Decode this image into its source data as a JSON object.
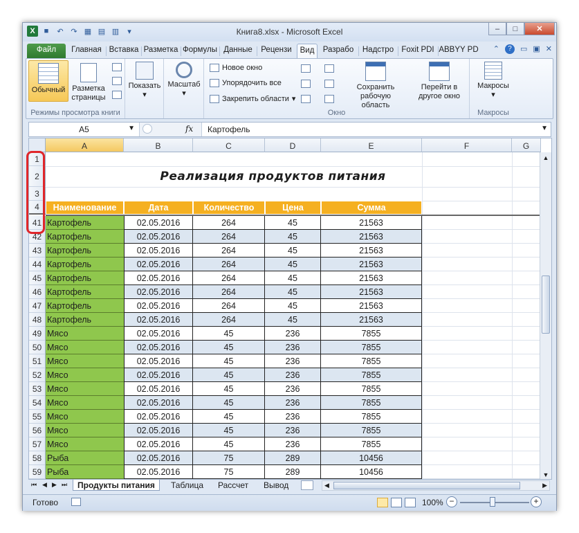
{
  "window": {
    "title": "Книга8.xlsx - Microsoft Excel"
  },
  "ribbon_tabs": [
    {
      "label": "Файл",
      "kind": "file"
    },
    {
      "label": "Главная"
    },
    {
      "label": "Вставка"
    },
    {
      "label": "Разметка"
    },
    {
      "label": "Формулы"
    },
    {
      "label": "Данные"
    },
    {
      "label": "Рецензи"
    },
    {
      "label": "Вид",
      "kind": "active"
    },
    {
      "label": "Разрабо"
    },
    {
      "label": "Надстро"
    },
    {
      "label": "Foxit PDI"
    },
    {
      "label": "ABBYY PD"
    }
  ],
  "ribbon": {
    "group1": {
      "label": "Режимы просмотра книги",
      "normal": "Обычный",
      "page_layout": "Разметка страницы"
    },
    "group2": {
      "show": "Показать"
    },
    "group3": {
      "zoom": "Масштаб"
    },
    "window_group": {
      "label": "Окно",
      "new_window": "Новое окно",
      "arrange_all": "Упорядочить все",
      "freeze_panes": "Закрепить области",
      "save_workspace": "Сохранить рабочую область",
      "switch_windows": "Перейти в другое окно"
    },
    "macros": {
      "button": "Макросы",
      "label": "Макросы"
    }
  },
  "formula_bar": {
    "name_box": "A5",
    "fx": "fx",
    "value": "Картофель"
  },
  "columns": [
    "A",
    "B",
    "C",
    "D",
    "E",
    "F",
    "G"
  ],
  "sheet": {
    "title": "Реализация продуктов питания",
    "headers": [
      "Наименование",
      "Дата",
      "Количество",
      "Цена",
      "Сумма"
    ],
    "top_rows": [
      "1",
      "2",
      "3",
      "4"
    ],
    "rows": [
      {
        "num": "41",
        "name": "Картофель",
        "date": "02.05.2016",
        "qty": "264",
        "price": "45",
        "sum": "21563"
      },
      {
        "num": "42",
        "name": "Картофель",
        "date": "02.05.2016",
        "qty": "264",
        "price": "45",
        "sum": "21563"
      },
      {
        "num": "43",
        "name": "Картофель",
        "date": "02.05.2016",
        "qty": "264",
        "price": "45",
        "sum": "21563"
      },
      {
        "num": "44",
        "name": "Картофель",
        "date": "02.05.2016",
        "qty": "264",
        "price": "45",
        "sum": "21563"
      },
      {
        "num": "45",
        "name": "Картофель",
        "date": "02.05.2016",
        "qty": "264",
        "price": "45",
        "sum": "21563"
      },
      {
        "num": "46",
        "name": "Картофель",
        "date": "02.05.2016",
        "qty": "264",
        "price": "45",
        "sum": "21563"
      },
      {
        "num": "47",
        "name": "Картофель",
        "date": "02.05.2016",
        "qty": "264",
        "price": "45",
        "sum": "21563"
      },
      {
        "num": "48",
        "name": "Картофель",
        "date": "02.05.2016",
        "qty": "264",
        "price": "45",
        "sum": "21563"
      },
      {
        "num": "49",
        "name": "Мясо",
        "date": "02.05.2016",
        "qty": "45",
        "price": "236",
        "sum": "7855"
      },
      {
        "num": "50",
        "name": "Мясо",
        "date": "02.05.2016",
        "qty": "45",
        "price": "236",
        "sum": "7855"
      },
      {
        "num": "51",
        "name": "Мясо",
        "date": "02.05.2016",
        "qty": "45",
        "price": "236",
        "sum": "7855"
      },
      {
        "num": "52",
        "name": "Мясо",
        "date": "02.05.2016",
        "qty": "45",
        "price": "236",
        "sum": "7855"
      },
      {
        "num": "53",
        "name": "Мясо",
        "date": "02.05.2016",
        "qty": "45",
        "price": "236",
        "sum": "7855"
      },
      {
        "num": "54",
        "name": "Мясо",
        "date": "02.05.2016",
        "qty": "45",
        "price": "236",
        "sum": "7855"
      },
      {
        "num": "55",
        "name": "Мясо",
        "date": "02.05.2016",
        "qty": "45",
        "price": "236",
        "sum": "7855"
      },
      {
        "num": "56",
        "name": "Мясо",
        "date": "02.05.2016",
        "qty": "45",
        "price": "236",
        "sum": "7855"
      },
      {
        "num": "57",
        "name": "Мясо",
        "date": "02.05.2016",
        "qty": "45",
        "price": "236",
        "sum": "7855"
      },
      {
        "num": "58",
        "name": "Рыба",
        "date": "02.05.2016",
        "qty": "75",
        "price": "289",
        "sum": "10456"
      },
      {
        "num": "59",
        "name": "Рыба",
        "date": "02.05.2016",
        "qty": "75",
        "price": "289",
        "sum": "10456"
      }
    ]
  },
  "sheet_tabs": [
    "Продукты питания",
    "Таблица",
    "Рассчет",
    "Вывод"
  ],
  "status": {
    "ready": "Готово",
    "zoom": "100%"
  },
  "colors": {
    "header_fill": "#f5b021",
    "name_fill": "#8fc74d",
    "odd_row": "#dce6f1",
    "highlight": "#e0262a"
  }
}
